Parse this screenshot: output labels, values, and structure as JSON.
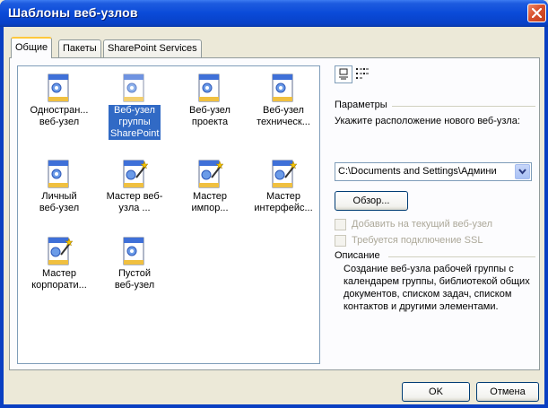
{
  "window": {
    "title": "Шаблоны веб-узлов"
  },
  "tabs": [
    {
      "label": "Общие",
      "active": true
    },
    {
      "label": "Пакеты",
      "active": false
    },
    {
      "label": "SharePoint Services",
      "active": false
    }
  ],
  "templates": [
    {
      "label": "Одностран... веб-узел",
      "icon": "page-icon",
      "selected": false
    },
    {
      "label": "Веб-узел группы SharePoint",
      "icon": "page-icon",
      "selected": true
    },
    {
      "label": "Веб-узел проекта",
      "icon": "page-icon",
      "selected": false
    },
    {
      "label": "Веб-узел техническ...",
      "icon": "page-icon",
      "selected": false
    },
    {
      "label": "Личный веб-узел",
      "icon": "page-icon",
      "selected": false
    },
    {
      "label": "Мастер веб-узла ...",
      "icon": "wizard-icon",
      "selected": false
    },
    {
      "label": "Мастер импор...",
      "icon": "wizard-icon",
      "selected": false
    },
    {
      "label": "Мастер интерфейс...",
      "icon": "wizard-icon",
      "selected": false
    },
    {
      "label": "Мастер корпорати...",
      "icon": "wizard-icon",
      "selected": false
    },
    {
      "label": "Пустой веб-узел",
      "icon": "page-icon",
      "selected": false
    }
  ],
  "view_buttons": {
    "large_icons": "large-icons-view-icon",
    "details": "details-view-icon"
  },
  "params": {
    "caption": "Параметры",
    "location_label": "Укажите расположение нового веб-узла:",
    "location_value": "C:\\Documents and Settings\\Админи",
    "browse_label": "Обзор...",
    "add_to_current_label": "Добавить на текущий веб-узел",
    "ssl_label": "Требуется подключение SSL"
  },
  "description": {
    "caption": "Описание",
    "text": "Создание веб-узла рабочей группы с календарем группы, библиотекой общих документов, списком задач, списком контактов и другими элементами."
  },
  "buttons": {
    "ok": "OK",
    "cancel": "Отмена"
  },
  "colors": {
    "titlebar": "#0a4ad8",
    "selection": "#316ac5",
    "face": "#ece9d8",
    "close": "#d8502c"
  }
}
